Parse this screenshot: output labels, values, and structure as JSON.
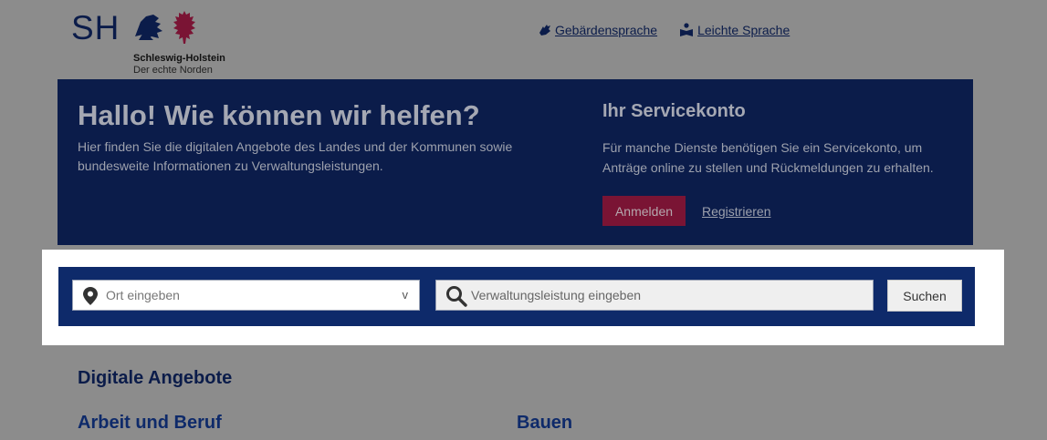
{
  "header": {
    "logo": {
      "abbr": "SH",
      "name": "Schleswig-Holstein",
      "slogan": "Der echte Norden"
    },
    "links": [
      {
        "label": "Gebärdensprache",
        "icon": "sign-language-icon"
      },
      {
        "label": "Leichte Sprache",
        "icon": "easy-language-icon"
      }
    ]
  },
  "hero": {
    "title": "Hallo! Wie können wir helfen?",
    "text": "Hier finden Sie die digitalen Angebote des Landes und der Kommunen sowie bundesweite Informationen zu Verwaltungsleistungen.",
    "servicekonto": {
      "title": "Ihr Servicekonto",
      "text": "Für manche Dienste benötigen Sie ein Servicekonto, um Anträge online zu stellen und Rückmeldungen zu erhalten.",
      "login_label": "Anmelden",
      "register_label": "Registrieren"
    }
  },
  "search": {
    "place_placeholder": "Ort eingeben",
    "place_chevron": "v",
    "service_placeholder": "Verwaltungsleistung eingeben",
    "button_label": "Suchen"
  },
  "main": {
    "section_title": "Digitale Angebote",
    "categories": [
      "Arbeit und Beruf",
      "Bauen"
    ]
  },
  "colors": {
    "navy": "#0b1c4a",
    "search_bar": "#0e2a6a",
    "accent_red": "#7a1434",
    "overlay": "#8c8c8c"
  }
}
